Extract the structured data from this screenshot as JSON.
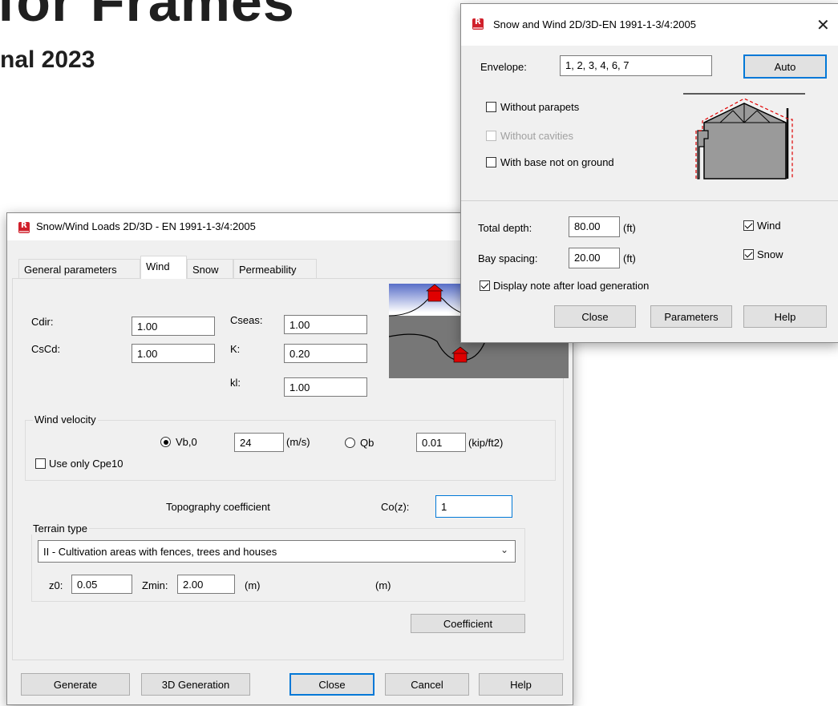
{
  "background": {
    "heading": "for Frames",
    "subheading": "nal 2023"
  },
  "wind_dialog": {
    "title": "Snow/Wind Loads 2D/3D - EN 1991-1-3/4:2005",
    "icon": "robot-app-icon",
    "tabs": [
      "General parameters",
      "Wind",
      "Snow",
      "Permeability"
    ],
    "active_tab": "Wind",
    "cdir_label": "Cdir:",
    "cdir_value": "1.00",
    "cscd_label": "CsCd:",
    "cscd_value": "1.00",
    "cseas_label": "Cseas:",
    "cseas_value": "1.00",
    "k_label": "K:",
    "k_value": "0.20",
    "kl_label": "kl:",
    "kl_value": "1.00",
    "wind_velocity": {
      "group_label": "Wind velocity",
      "vb0_label": "Vb,0",
      "vb0_value": "24",
      "vb0_unit": "(m/s)",
      "vb0_selected": true,
      "qb_label": "Qb",
      "qb_value": "0.01",
      "qb_unit": "(kip/ft2)",
      "use_cpe10_label": "Use only Cpe10",
      "use_cpe10_checked": false
    },
    "topography_label": "Topography coefficient",
    "co_label": "Co(z):",
    "co_value": "1",
    "terrain": {
      "group_label": "Terrain type",
      "selected": "II - Cultivation areas with fences, trees and houses",
      "z0_label": "z0:",
      "z0_value": "0.05",
      "zmin_label": "Zmin:",
      "zmin_value": "2.00",
      "unit_m1": "(m)",
      "unit_m2": "(m)"
    },
    "coefficient_button": "Coefficient",
    "buttons": {
      "generate": "Generate",
      "generation_3d": "3D Generation",
      "close": "Close",
      "cancel": "Cancel",
      "help": "Help"
    }
  },
  "snow_dialog": {
    "title": "Snow and Wind 2D/3D-EN 1991-1-3/4:2005",
    "envelope_label": "Envelope:",
    "envelope_value": "1, 2, 3, 4, 6, 7",
    "auto_button": "Auto",
    "without_parapets": "Without parapets",
    "without_parapets_checked": false,
    "without_cavities": "Without cavities",
    "without_cavities_enabled": false,
    "base_not_on_ground": "With base not on ground",
    "base_not_on_ground_checked": false,
    "total_depth_label": "Total depth:",
    "total_depth_value": "80.00",
    "total_depth_unit": "(ft)",
    "bay_spacing_label": "Bay spacing:",
    "bay_spacing_value": "20.00",
    "bay_spacing_unit": "(ft)",
    "wind_label": "Wind",
    "wind_checked": true,
    "snow_label": "Snow",
    "snow_checked": true,
    "display_note_label": "Display note after load generation",
    "display_note_checked": true,
    "buttons": {
      "close": "Close",
      "parameters": "Parameters",
      "help": "Help"
    }
  },
  "colors": {
    "accent": "#0078d7",
    "roof_red": "#e00000",
    "hill_gray": "#777777",
    "sky_blue": "#1030b0"
  }
}
